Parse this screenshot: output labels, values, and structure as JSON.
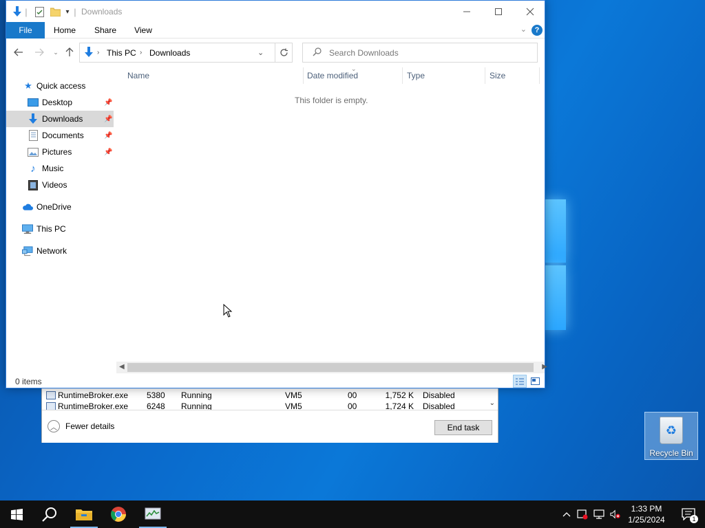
{
  "explorer": {
    "title": "Downloads",
    "tabs": [
      {
        "label": "File"
      },
      {
        "label": "Home"
      },
      {
        "label": "Share"
      },
      {
        "label": "View"
      }
    ],
    "help_glyph": "?",
    "address": {
      "crumbs": [
        "This PC",
        "Downloads"
      ]
    },
    "search": {
      "placeholder": "Search Downloads"
    },
    "nav": {
      "quick_access": "Quick access",
      "items": [
        {
          "label": "Desktop",
          "icon": "desktop-icon",
          "pinned": true
        },
        {
          "label": "Downloads",
          "icon": "downloads-icon",
          "pinned": true,
          "selected": true
        },
        {
          "label": "Documents",
          "icon": "documents-icon",
          "pinned": true
        },
        {
          "label": "Pictures",
          "icon": "pictures-icon",
          "pinned": true
        },
        {
          "label": "Music",
          "icon": "music-icon",
          "pinned": false
        },
        {
          "label": "Videos",
          "icon": "videos-icon",
          "pinned": false
        }
      ],
      "onedrive": "OneDrive",
      "this_pc": "This PC",
      "network": "Network"
    },
    "columns": [
      "Name",
      "Date modified",
      "Type",
      "Size"
    ],
    "empty_message": "This folder is empty.",
    "status": "0 items",
    "accent_color": "#1979ca"
  },
  "taskmgr": {
    "rows": [
      {
        "name": "RuntimeBroker.exe",
        "pid": "5380",
        "status": "Running",
        "user": "VM5",
        "cpu": "00",
        "memory": "1,752 K",
        "uac": "Disabled"
      },
      {
        "name": "RuntimeBroker.exe",
        "pid": "6248",
        "status": "Running",
        "user": "VM5",
        "cpu": "00",
        "memory": "1,724 K",
        "uac": "Disabled"
      }
    ],
    "fewer_details": "Fewer details",
    "end_task": "End task"
  },
  "desktop": {
    "recycle_bin": "Recycle Bin"
  },
  "taskbar": {
    "apps": [
      "start-icon",
      "search-icon",
      "file-explorer-icon",
      "chrome-icon",
      "task-manager-icon"
    ],
    "time": "1:33 PM",
    "date": "1/25/2024",
    "notification_count": "1",
    "background": "#101010"
  }
}
